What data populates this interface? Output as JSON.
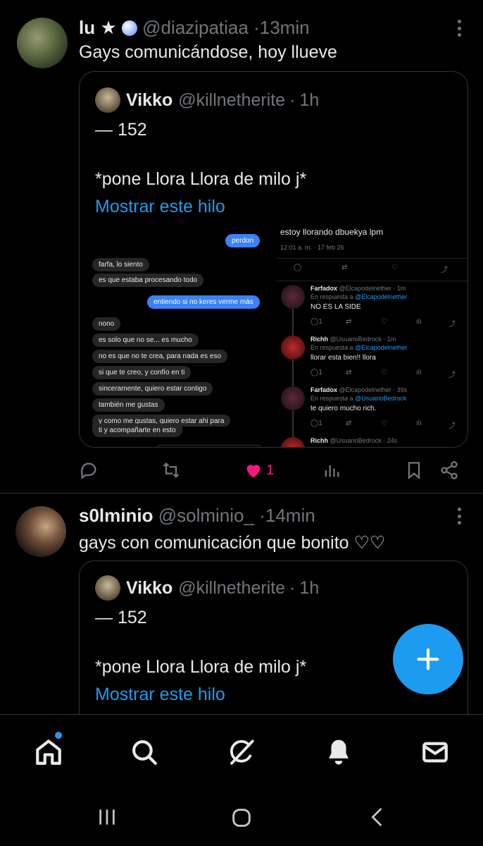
{
  "tweet1": {
    "name": "lu",
    "name_emoji": "★",
    "handle": "@diazipatiaa",
    "separator": "·",
    "time": "13min",
    "text": "Gays comunicándose, hoy llueve",
    "quote": {
      "name": "Vikko",
      "handle": "@killnetherite",
      "separator": "·",
      "time": "1h",
      "line1": "— 152",
      "line2": "*pone Llora Llora de milo j*",
      "link": "Mostrar este hilo"
    },
    "media": {
      "chat": [
        {
          "dir": "out",
          "text": "perdon"
        },
        {
          "dir": "in",
          "text": "farfa, lo siento"
        },
        {
          "dir": "in",
          "text": "es que estaba procesando todo"
        },
        {
          "dir": "out",
          "text": "entiendo si no keres verme más"
        },
        {
          "dir": "in",
          "text": "nono"
        },
        {
          "dir": "in",
          "text": "es solo que no se... es mucho"
        },
        {
          "dir": "in",
          "text": "no es que no te crea, para nada es eso"
        },
        {
          "dir": "in",
          "text": "si que te creo, y confío en ti"
        },
        {
          "dir": "in",
          "text": "sinceramente, quiero estar contigo"
        },
        {
          "dir": "in",
          "text": "también me gustas"
        },
        {
          "dir": "in",
          "text": "y como me gustas, quiero estar ahi para"
        },
        {
          "dir": "in",
          "text": "ti y acompañarte en esto"
        }
      ],
      "post_text": "estoy llorando dbuekya lpm",
      "post_time": "12:01 a. m. · 17 feb 26",
      "replies": [
        {
          "name": "Farfadox",
          "handle": "@Elcapodelnether",
          "time": "· 1m",
          "reply_prefix": "En respuesta a",
          "reply_to": "@Elcapodelnether",
          "text": "NO ES LA SIDE",
          "count": "1"
        },
        {
          "name": "Richh",
          "handle": "@UsuarioBedrock",
          "time": "· 1m",
          "reply_prefix": "En respuesta a",
          "reply_to": "@Elcapodelnether",
          "text": "llorar esta bien!! llora",
          "count": "1"
        },
        {
          "name": "Farfadox",
          "handle": "@Elcapodelnether",
          "time": "· 39s",
          "reply_prefix": "En respuesta a",
          "reply_to": "@UsuarioBedrock",
          "text": "te quiero mucho rich.",
          "count": "1"
        },
        {
          "name": "Richh",
          "handle": "@UsuarioBedrock",
          "time": "· 24s",
          "reply_prefix": "",
          "reply_to": "",
          "text": "",
          "count": ""
        }
      ]
    },
    "likes": "1"
  },
  "tweet2": {
    "name": "s0lminio",
    "handle": "@solminio_",
    "separator": "·",
    "time": "14min",
    "text": "gays con comunicación que bonito ♡♡",
    "quote": {
      "name": "Vikko",
      "handle": "@killnetherite",
      "separator": "·",
      "time": "1h",
      "line1": "— 152",
      "line2": "*pone Llora Llora de milo j*",
      "link": "Mostrar este hilo"
    }
  },
  "colors": {
    "accent": "#1d9bf0",
    "like": "#f91880",
    "muted": "#71767b",
    "background": "#000000"
  },
  "icons": [
    "reply-icon",
    "retweet-icon",
    "heart-icon",
    "views-icon",
    "bookmark-icon",
    "share-icon",
    "home-icon",
    "search-icon",
    "grok-icon",
    "bell-icon",
    "mail-icon",
    "plus-icon"
  ]
}
